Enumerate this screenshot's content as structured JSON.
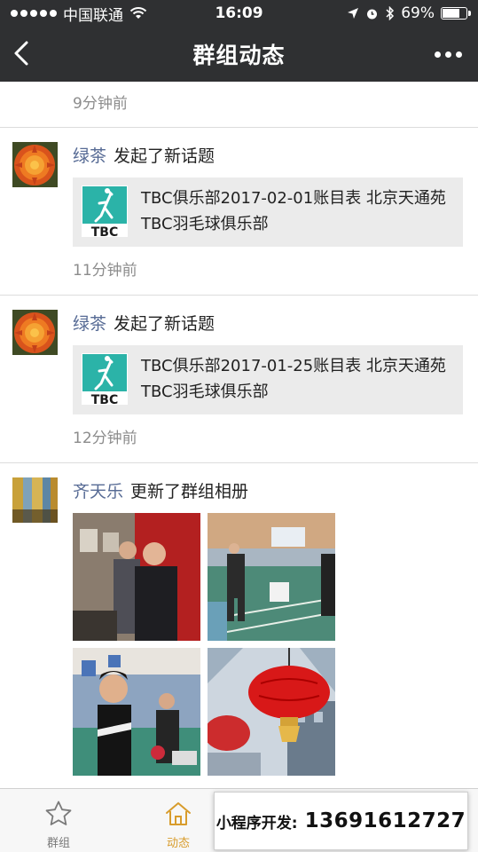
{
  "status_bar": {
    "carrier": "中国联通",
    "time": "16:09",
    "battery_percent": "69%",
    "battery_level": 0.69
  },
  "nav": {
    "title": "群组动态"
  },
  "feed": {
    "top_time": "9分钟前",
    "posts": [
      {
        "author": "绿茶",
        "action": "发起了新话题",
        "card_text": "TBC俱乐部2017-02-01账目表 北京天通苑TBC羽毛球俱乐部",
        "time": "11分钟前"
      },
      {
        "author": "绿茶",
        "action": "发起了新话题",
        "card_text": "TBC俱乐部2017-01-25账目表 北京天通苑TBC羽毛球俱乐部",
        "time": "12分钟前"
      },
      {
        "author": "齐天乐",
        "action": "更新了群组相册",
        "photo_count": 4
      }
    ]
  },
  "tabbar": {
    "tabs": [
      {
        "label": "群组",
        "icon": "star-icon"
      },
      {
        "label": "动态",
        "icon": "home-icon"
      }
    ]
  },
  "promo": {
    "label": "小程序开发:",
    "phone": "13691612727"
  },
  "colors": {
    "nav_bg": "#2f3032",
    "author_blue": "#576b95",
    "active_tab": "#d89c2c",
    "card_bg": "#ebebeb"
  }
}
